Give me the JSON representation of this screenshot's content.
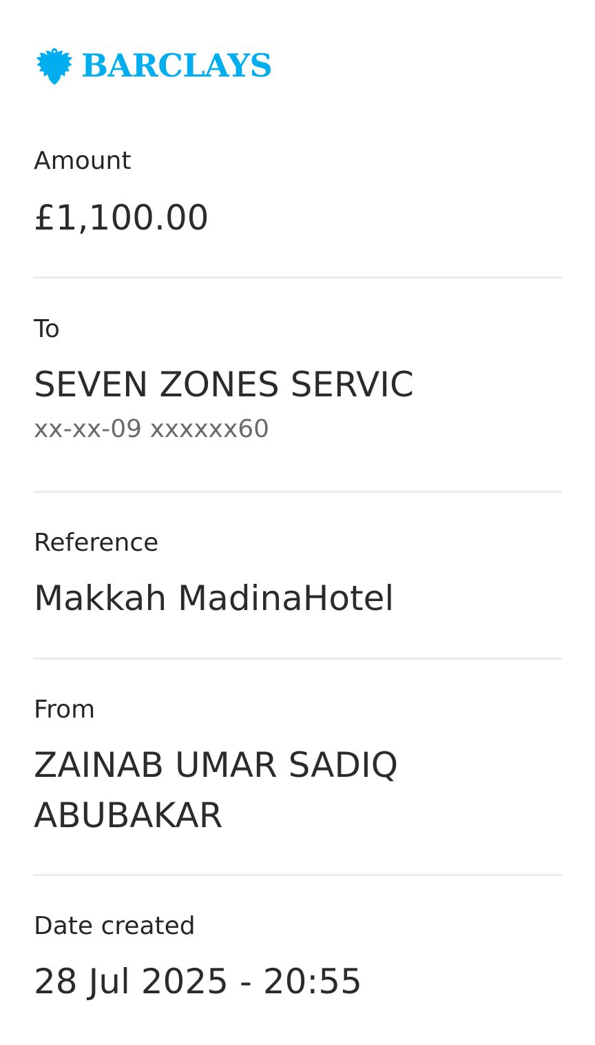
{
  "brand": {
    "name": "BARCLAYS",
    "icon": "eagle-icon",
    "color": "#00aeef"
  },
  "fields": {
    "amount": {
      "label": "Amount",
      "value": "£1,100.00"
    },
    "to": {
      "label": "To",
      "value": "SEVEN ZONES SERVIC",
      "account": "xx-xx-09 xxxxxx60"
    },
    "reference": {
      "label": "Reference",
      "value": "Makkah MadinaHotel"
    },
    "from": {
      "label": "From",
      "value_line1": "ZAINAB UMAR SADIQ",
      "value_line2": "ABUBAKAR"
    },
    "date_created": {
      "label": "Date created",
      "value": "28 Jul 2025 - 20:55"
    }
  }
}
